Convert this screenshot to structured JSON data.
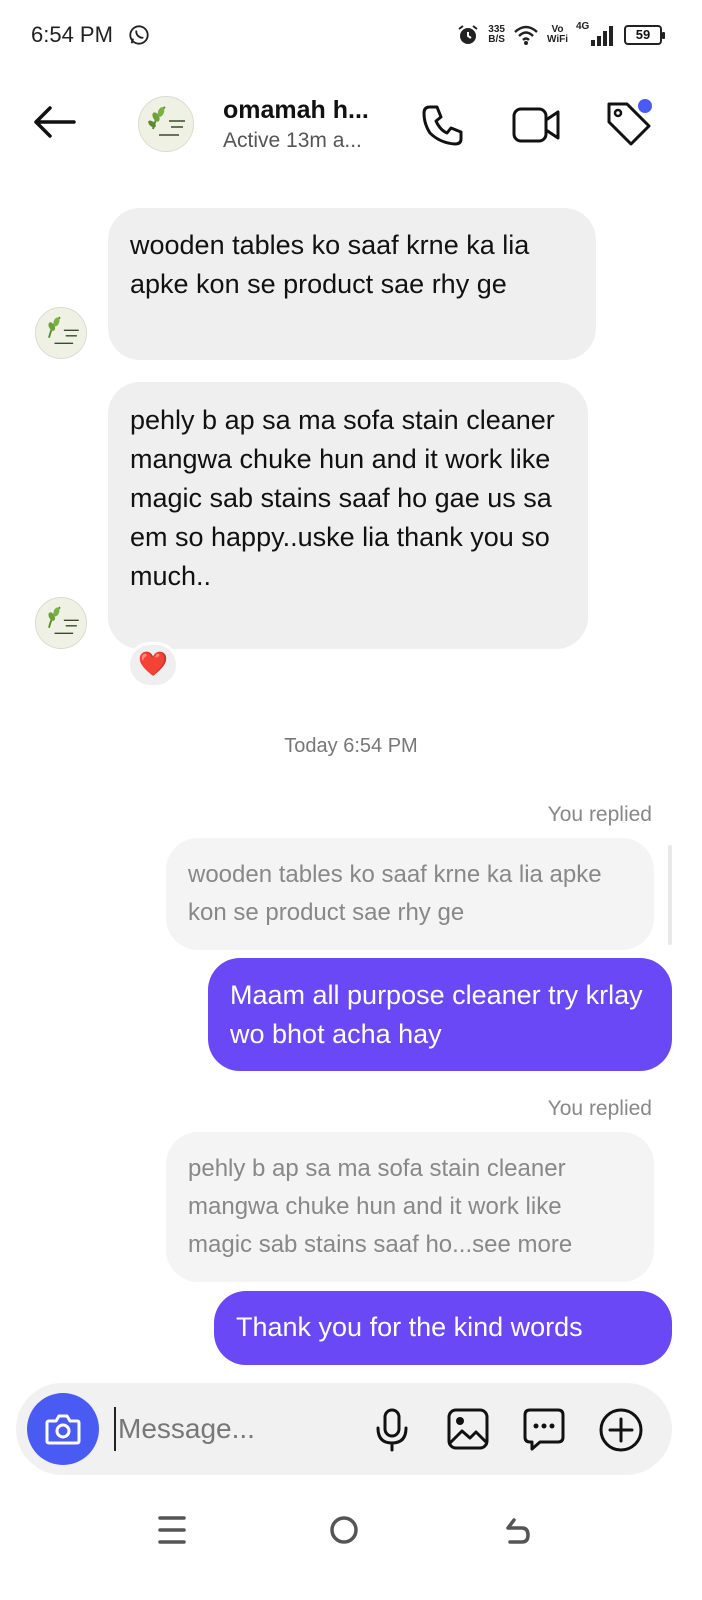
{
  "status_bar": {
    "time": "6:54 PM",
    "net_speed_value": "335",
    "net_speed_unit": "B/S",
    "volte_top": "Vo",
    "volte_bottom": "WiFi",
    "network": "4G",
    "battery": "59"
  },
  "header": {
    "contact_name": "omamah h...",
    "contact_status": "Active 13m a..."
  },
  "messages": {
    "incoming_1": "wooden tables ko saaf krne ka lia apke kon se product sae rhy ge",
    "incoming_2": "pehly b ap sa ma sofa stain cleaner mangwa chuke hun and it work like magic sab stains saaf ho gae us sa em so happy..uske lia thank you so much..",
    "reaction": "❤️",
    "timestamp": "Today 6:54 PM",
    "reply_1_label": "You replied",
    "reply_1_quote": "wooden tables ko saaf krne ka lia apke kon se product sae rhy ge",
    "reply_1_text": "Maam all purpose cleaner try krlay wo bhot acha hay",
    "reply_2_label": "You replied",
    "reply_2_quote": "pehly b ap sa ma sofa stain cleaner mangwa chuke hun and it work like magic sab stains saaf ho...see more",
    "reply_2_text": "Thank you for the kind words"
  },
  "composer": {
    "placeholder": "Message..."
  },
  "colors": {
    "outgoing_bubble": "#6b48f5",
    "camera_button": "#4a5bf4",
    "notification_dot": "#4a5bf4"
  },
  "icons": {
    "header": [
      "back-arrow-icon",
      "phone-icon",
      "video-icon",
      "tag-icon"
    ],
    "composer": [
      "camera-icon",
      "microphone-icon",
      "gallery-icon",
      "sticker-icon",
      "plus-icon"
    ],
    "navbar": [
      "menu-icon",
      "home-icon",
      "back-icon"
    ]
  }
}
